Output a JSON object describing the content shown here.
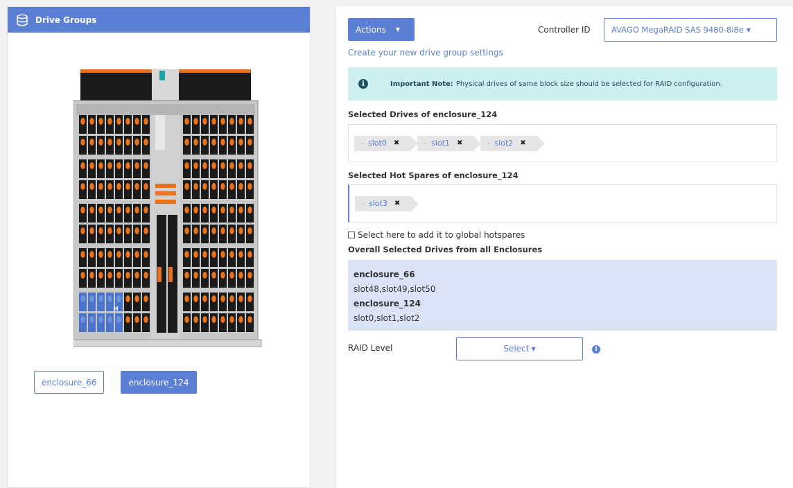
{
  "left": {
    "header_title": "Drive Groups",
    "enclosure_buttons": [
      {
        "label": "enclosure_66",
        "active": false
      },
      {
        "label": "enclosure_124",
        "active": true
      }
    ],
    "chassis_hotspare_marker": "H"
  },
  "right": {
    "actions_label": "Actions",
    "controller_label": "Controller ID",
    "controller_value": "AVAGO MegaRAID SAS 9480-8i8e",
    "create_link": "Create your new drive group settings",
    "note_bold": "Important Note:",
    "note_text": "Physical drives of same block size should be selected for RAID configuration.",
    "selected_drives_label": "Selected Drives of enclosure_124",
    "selected_drives": [
      "slot0",
      "slot1",
      "slot2"
    ],
    "hot_spares_label": "Selected Hot Spares of enclosure_124",
    "hot_spares": [
      "slot3"
    ],
    "global_hotspare_label": "Select here to add it to global hotspares",
    "overall_label": "Overall Selected Drives from all Enclosures",
    "overall": [
      {
        "enclosure": "enclosure_66",
        "slots": "slot48,slot49,slot50"
      },
      {
        "enclosure": "enclosure_124",
        "slots": "slot0,slot1,slot2"
      }
    ],
    "raid_label": "RAID Level",
    "raid_select": "Select"
  },
  "colors": {
    "accent": "#5b7fd4",
    "note_bg": "#cdeff0",
    "overall_bg": "#dde3f7",
    "drive_orange": "#e8731f",
    "selected_drive_blue": "#4a74c9"
  },
  "icons": [
    "database-icon",
    "info-icon",
    "caret-down-icon",
    "close-icon"
  ]
}
